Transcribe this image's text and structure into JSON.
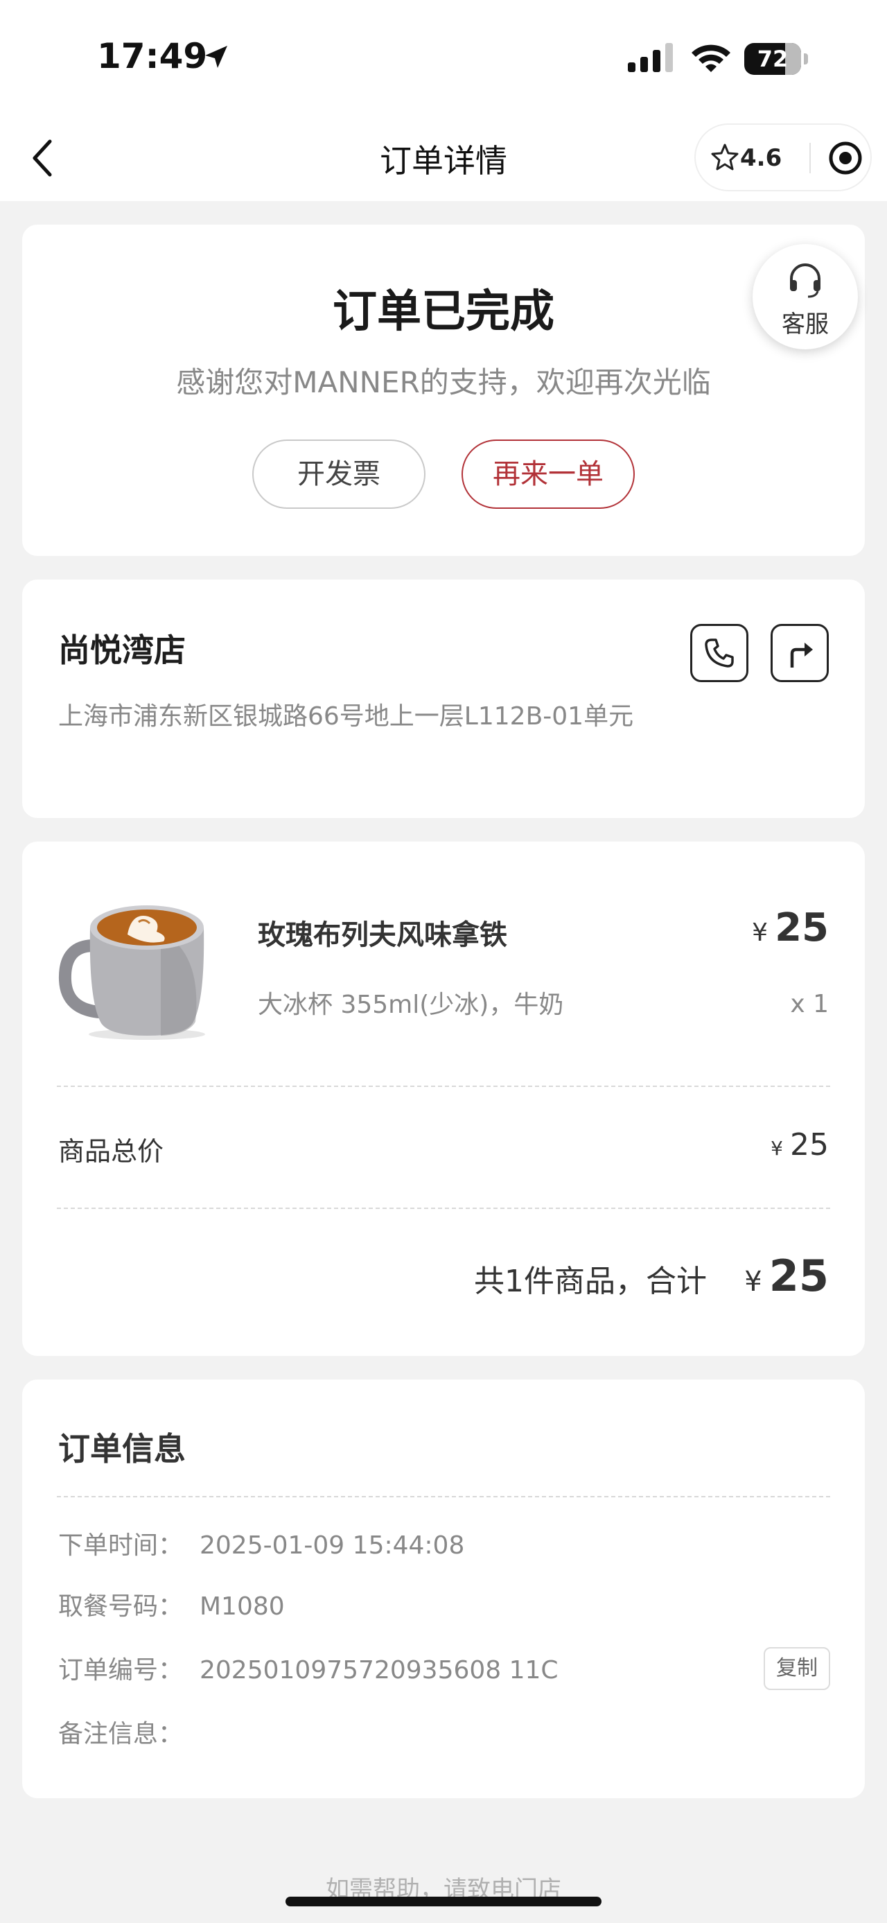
{
  "status_bar": {
    "time": "17:49",
    "battery": "72",
    "battery_level": 0.72
  },
  "nav": {
    "title": "订单详情",
    "rating": "4.6"
  },
  "order_status": {
    "title": "订单已完成",
    "subtitle": "感谢您对MANNER的支持，欢迎再次光临",
    "invoice_button": "开发票",
    "reorder_button": "再来一单",
    "service_label": "客服"
  },
  "store": {
    "name": "尚悦湾店",
    "address": "上海市浦东新区银城路66号地上一层L112B-01单元"
  },
  "item": {
    "name": "玫瑰布列夫风味拿铁",
    "spec": "大冰杯 355ml(少冰)，牛奶",
    "currency": "¥",
    "price": "25",
    "qty": "x 1"
  },
  "summary": {
    "total_label": "商品总价",
    "total": "25",
    "count_label": "共1件商品，合计",
    "grand_total": "25"
  },
  "order_info": {
    "title": "订单信息",
    "rows": [
      {
        "key": "下单时间：",
        "value": "2025-01-09 15:44:08"
      },
      {
        "key": "取餐号码：",
        "value": "M1080"
      },
      {
        "key": "订单编号：",
        "value": "2025010975720935608 11C"
      },
      {
        "key": "备注信息：",
        "value": ""
      }
    ],
    "copy_button": "复制"
  },
  "footer": {
    "help_text": "如需帮助，请致电门店"
  },
  "colors": {
    "accent": "#b23238",
    "background": "#f2f2f2"
  }
}
